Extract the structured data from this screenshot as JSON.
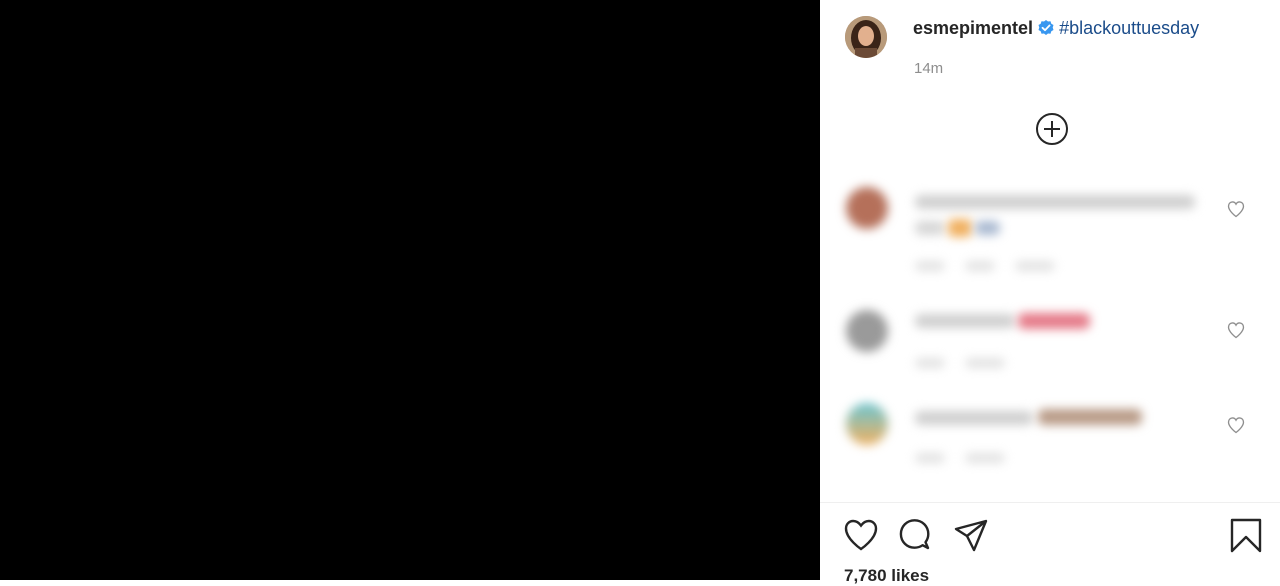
{
  "post": {
    "username": "esmepimentel",
    "caption": "#blackouttuesday",
    "time": "14m",
    "likes": "7,780 likes"
  },
  "icons": {
    "verified": "verified-badge-icon",
    "load_more": "plus-circle-icon",
    "like": "heart-icon",
    "comment": "comment-icon",
    "share": "share-icon",
    "save": "bookmark-icon"
  },
  "colors": {
    "verified": "#3897f0",
    "hashtag": "#1b4c8a",
    "muted": "#8e8e8e"
  }
}
